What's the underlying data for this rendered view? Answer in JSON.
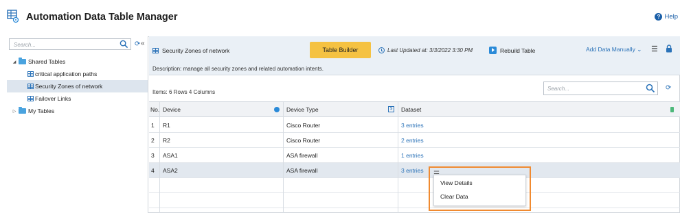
{
  "app": {
    "title": "Automation Data Table Manager",
    "help_label": "Help"
  },
  "left_panel": {
    "search_placeholder": "Search...",
    "tree": [
      {
        "label": "Shared Tables",
        "type": "folder",
        "expanded": true
      },
      {
        "label": "critical application paths",
        "type": "table"
      },
      {
        "label": "Security Zones of network",
        "type": "table",
        "selected": true
      },
      {
        "label": "Failover Links",
        "type": "table"
      },
      {
        "label": "My Tables",
        "type": "folder",
        "expanded": false
      }
    ]
  },
  "table_header": {
    "name": "Security Zones of network",
    "builder_label": "Table Builder",
    "last_updated": "Last Updated at: 3/3/2022 3:30 PM",
    "rebuild_label": "Rebuild Table",
    "add_data_label": "Add Data Manually",
    "description": "Description:  manage all security zones and related automation intents."
  },
  "summary": {
    "items_label": "Items:  6 Rows  4 Columns",
    "search_placeholder": "Search..."
  },
  "grid": {
    "columns": [
      "No.",
      "Device",
      "Device Type",
      "Dataset"
    ],
    "rows": [
      {
        "no": "1",
        "device": "R1",
        "type": "Cisco Router",
        "dataset": "3 entries"
      },
      {
        "no": "2",
        "device": "R2",
        "type": "Cisco Router",
        "dataset": "2 entries"
      },
      {
        "no": "3",
        "device": "ASA1",
        "type": "ASA firewall",
        "dataset": "1 entries"
      },
      {
        "no": "4",
        "device": "ASA2",
        "type": "ASA firewall",
        "dataset": "3 entries"
      }
    ]
  },
  "context_menu": {
    "items": [
      "View Details",
      "Clear Data"
    ]
  },
  "colors": {
    "accent": "#2a72b8",
    "builder": "#f5c242",
    "highlight": "#f08a30",
    "selected_row": "#e2e8ef"
  }
}
